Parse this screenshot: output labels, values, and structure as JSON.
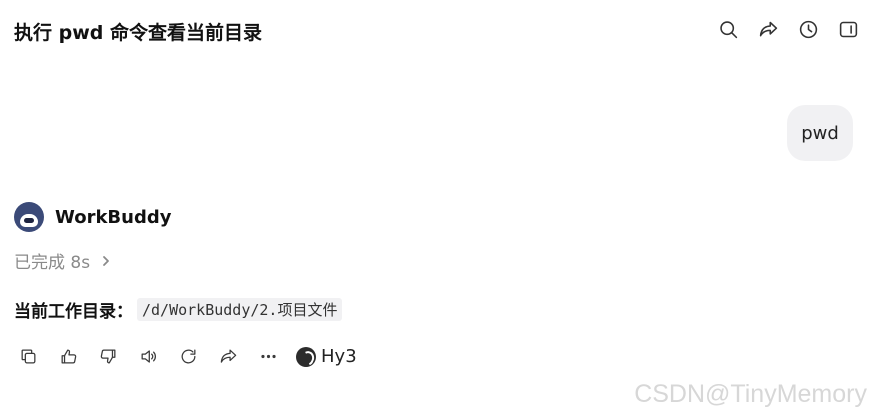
{
  "header": {
    "title": "执行 pwd 命令查看当前目录",
    "icons": [
      "search-icon",
      "share-icon",
      "history-icon",
      "sidebar-toggle-icon"
    ]
  },
  "user_message": {
    "text": "pwd"
  },
  "assistant": {
    "name": "WorkBuddy",
    "status": "已完成 8s",
    "answer_label": "当前工作目录：",
    "answer_code": "/d/WorkBuddy/2.项目文件"
  },
  "actions": {
    "icons": [
      "copy-icon",
      "thumbs-up-icon",
      "thumbs-down-icon",
      "speaker-icon",
      "refresh-icon",
      "share-icon",
      "more-icon"
    ],
    "model_label": "Hy3"
  },
  "watermark": "CSDN@TinyMemory"
}
